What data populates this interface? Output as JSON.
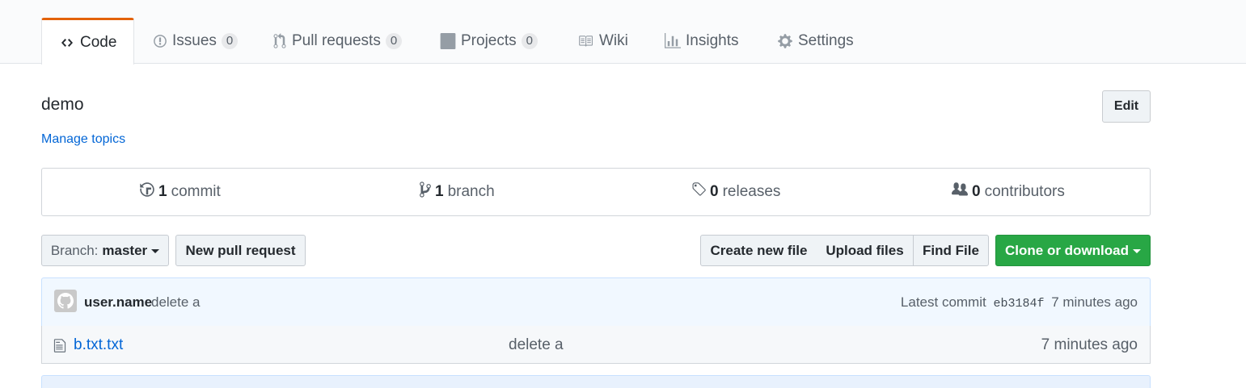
{
  "tabs": [
    {
      "label": "Code",
      "icon": "code-icon",
      "selected": true
    },
    {
      "label": "Issues",
      "icon": "issue-icon",
      "count": "0"
    },
    {
      "label": "Pull requests",
      "icon": "pull-request-icon",
      "count": "0"
    },
    {
      "label": "Projects",
      "icon": "project-icon",
      "count": "0"
    },
    {
      "label": "Wiki",
      "icon": "book-icon"
    },
    {
      "label": "Insights",
      "icon": "graph-icon"
    },
    {
      "label": "Settings",
      "icon": "gear-icon"
    }
  ],
  "repo": {
    "description": "demo",
    "manage_topics": "Manage topics",
    "edit_label": "Edit"
  },
  "summary": {
    "commits": {
      "num": "1",
      "label": "commit"
    },
    "branches": {
      "num": "1",
      "label": "branch"
    },
    "releases": {
      "num": "0",
      "label": "releases"
    },
    "contributors": {
      "num": "0",
      "label": "contributors"
    }
  },
  "toolbar": {
    "branch_prefix": "Branch:",
    "branch_name": "master",
    "new_pr": "New pull request",
    "create_file": "Create new file",
    "upload_files": "Upload files",
    "find_file": "Find File",
    "clone": "Clone or download"
  },
  "latest_commit": {
    "author": "user.name",
    "message": "delete a",
    "prefix": "Latest commit",
    "sha": "eb3184f",
    "age": "7 minutes ago"
  },
  "files": [
    {
      "name": "b.txt.txt",
      "message": "delete a",
      "age": "7 minutes ago"
    }
  ],
  "colors": {
    "accent": "#0366d6",
    "selected_tab_border": "#e36209",
    "clone_button": "#28a745",
    "commit_bar": "#f1f8ff"
  }
}
